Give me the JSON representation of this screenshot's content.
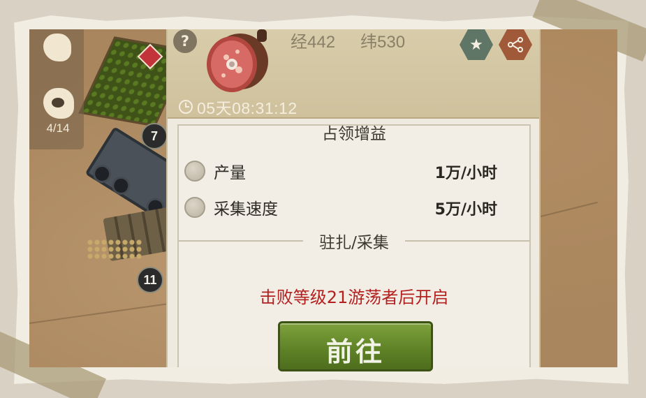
{
  "header": {
    "help_label": "?",
    "coord_x": "经442",
    "coord_y": "纬530",
    "timer": "05天08:31:12"
  },
  "map": {
    "slot_count": "4/14",
    "badges": [
      "7",
      "11"
    ]
  },
  "occupation": {
    "title": "占领增益",
    "rows": [
      {
        "label": "产量",
        "value": "1万/小时"
      },
      {
        "label": "采集速度",
        "value": "5万/小时"
      }
    ]
  },
  "garrison": {
    "title": "驻扎/采集",
    "unlock_note": "击败等级21游荡者后开启",
    "go_label": "前往"
  },
  "icons": {
    "resource": "meat-icon",
    "star": "star-icon",
    "share": "share-icon",
    "clock": "clock-icon"
  },
  "colors": {
    "warning": "#b32020",
    "go_button": "#5f8327",
    "star_hex": "#5f7566",
    "share_hex": "#a05a3a"
  }
}
